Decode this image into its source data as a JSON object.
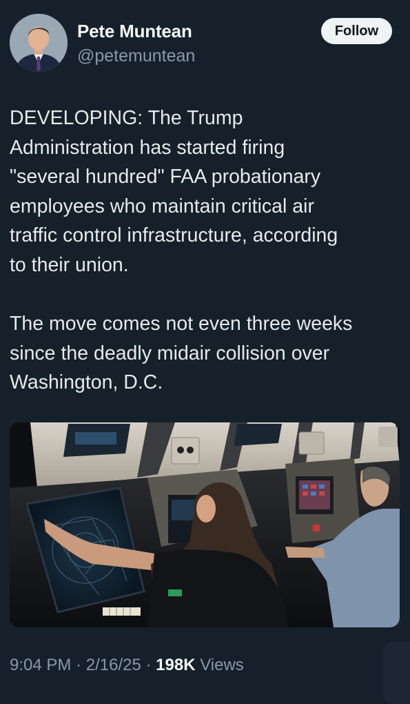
{
  "author": {
    "name": "Pete Muntean",
    "handle": "@petemuntean"
  },
  "follow_label": "Follow",
  "tweet": {
    "text": "DEVELOPING: The Trump\nAdministration has started firing\n\"several hundred\" FAA probationary\nemployees who maintain critical air\ntraffic control infrastructure, according\nto their union.\n\nThe move comes not even three weeks\nsince the deadly midair collision over\nWashington, D.C."
  },
  "meta": {
    "time": "9:04 PM",
    "separator": "·",
    "date": "2/16/25",
    "views_count": "198K",
    "views_label": "Views"
  },
  "colors": {
    "background": "#15202b",
    "text_primary": "#e7e9ea",
    "text_secondary": "#8b98a5",
    "follow_button_bg": "#eff3f4"
  }
}
